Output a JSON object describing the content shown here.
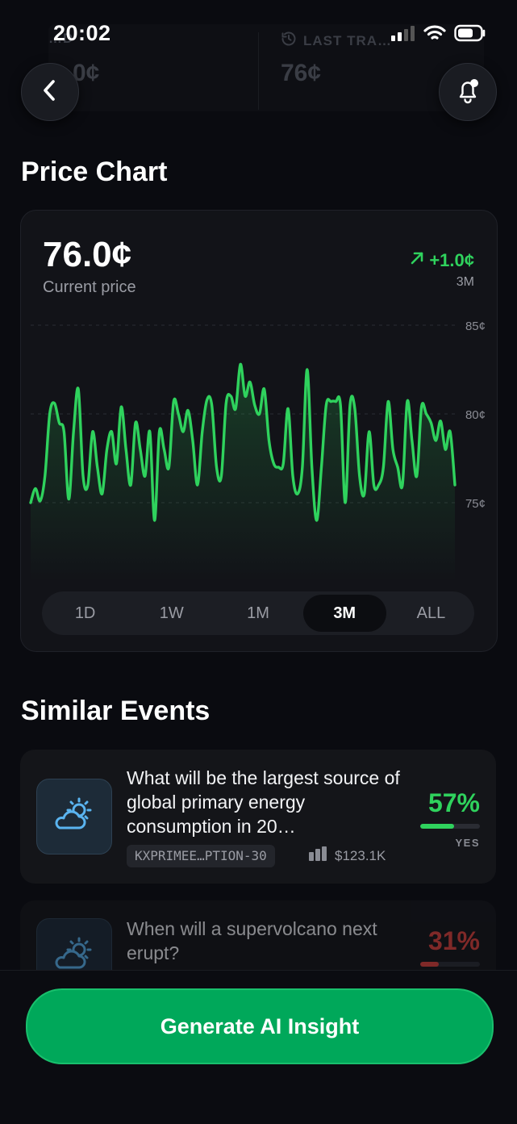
{
  "status_bar": {
    "time": "20:02"
  },
  "header_bg": {
    "left_label": "…D",
    "left_value": "…0¢",
    "right_label": "LAST TRA…",
    "right_value": "76¢"
  },
  "sections": {
    "price_chart_title": "Price Chart",
    "similar_events_title": "Similar Events"
  },
  "price": {
    "current": "76.0¢",
    "current_label": "Current price",
    "change": "+1.0¢",
    "range": "3M"
  },
  "range_tabs": [
    {
      "label": "1D",
      "active": false
    },
    {
      "label": "1W",
      "active": false
    },
    {
      "label": "1M",
      "active": false
    },
    {
      "label": "3M",
      "active": true
    },
    {
      "label": "ALL",
      "active": false
    }
  ],
  "chart_data": {
    "type": "line",
    "yticks": [
      "85¢",
      "80¢",
      "75¢"
    ],
    "ylim": [
      70,
      87
    ],
    "grid": true,
    "color": "#2fd25d",
    "series": [
      {
        "values": [
          75.0,
          75.8,
          75.1,
          76.5,
          80.0,
          80.6,
          79.5,
          79.0,
          75.2,
          79.0,
          81.4,
          76.5,
          76.0,
          79.0,
          77.0,
          75.5,
          78.0,
          79.0,
          77.2,
          80.4,
          78.0,
          76.0,
          79.5,
          78.0,
          76.5,
          79.0,
          74.0,
          79.0,
          78.0,
          77.0,
          80.7,
          80.0,
          79.0,
          80.2,
          78.5,
          76.0,
          79.0,
          80.8,
          80.5,
          77.0,
          76.5,
          80.6,
          81.0,
          80.3,
          82.8,
          81.0,
          81.8,
          80.5,
          80.0,
          81.4,
          78.5,
          77.2,
          77.0,
          77.2,
          80.3,
          76.5,
          75.5,
          77.0,
          82.5,
          77.0,
          74.0,
          77.0,
          80.5,
          80.7,
          80.7,
          80.5,
          75.0,
          80.5,
          80.3,
          76.5,
          75.5,
          79.0,
          76.0,
          76.0,
          77.0,
          80.7,
          78.0,
          77.0,
          76.0,
          80.7,
          78.5,
          76.5,
          80.4,
          80.0,
          79.5,
          78.5,
          79.6,
          78.0,
          79.0,
          76.0
        ]
      }
    ],
    "colors": {
      "line": "#2fd25d",
      "grid": "#2a2c33"
    }
  },
  "events": [
    {
      "title": "What will be the largest source of global primary energy consumption in 20…",
      "ticker": "KXPRIMEE…PTION-30",
      "volume": "$123.1K",
      "percent": "57%",
      "percent_value": 0.57,
      "side": "YES",
      "color": "#2fd25d",
      "icon": "partly-sunny-icon"
    },
    {
      "title": "When will a supervolcano next erupt?",
      "percent": "31%",
      "percent_value": 0.31,
      "color": "#e0423d",
      "icon": "partly-sunny-icon"
    }
  ],
  "cta": {
    "label": "Generate AI Insight"
  },
  "colors": {
    "accent": "#2fd25d",
    "background": "#0a0b10",
    "card": "#121318",
    "cta": "#00a85a"
  }
}
